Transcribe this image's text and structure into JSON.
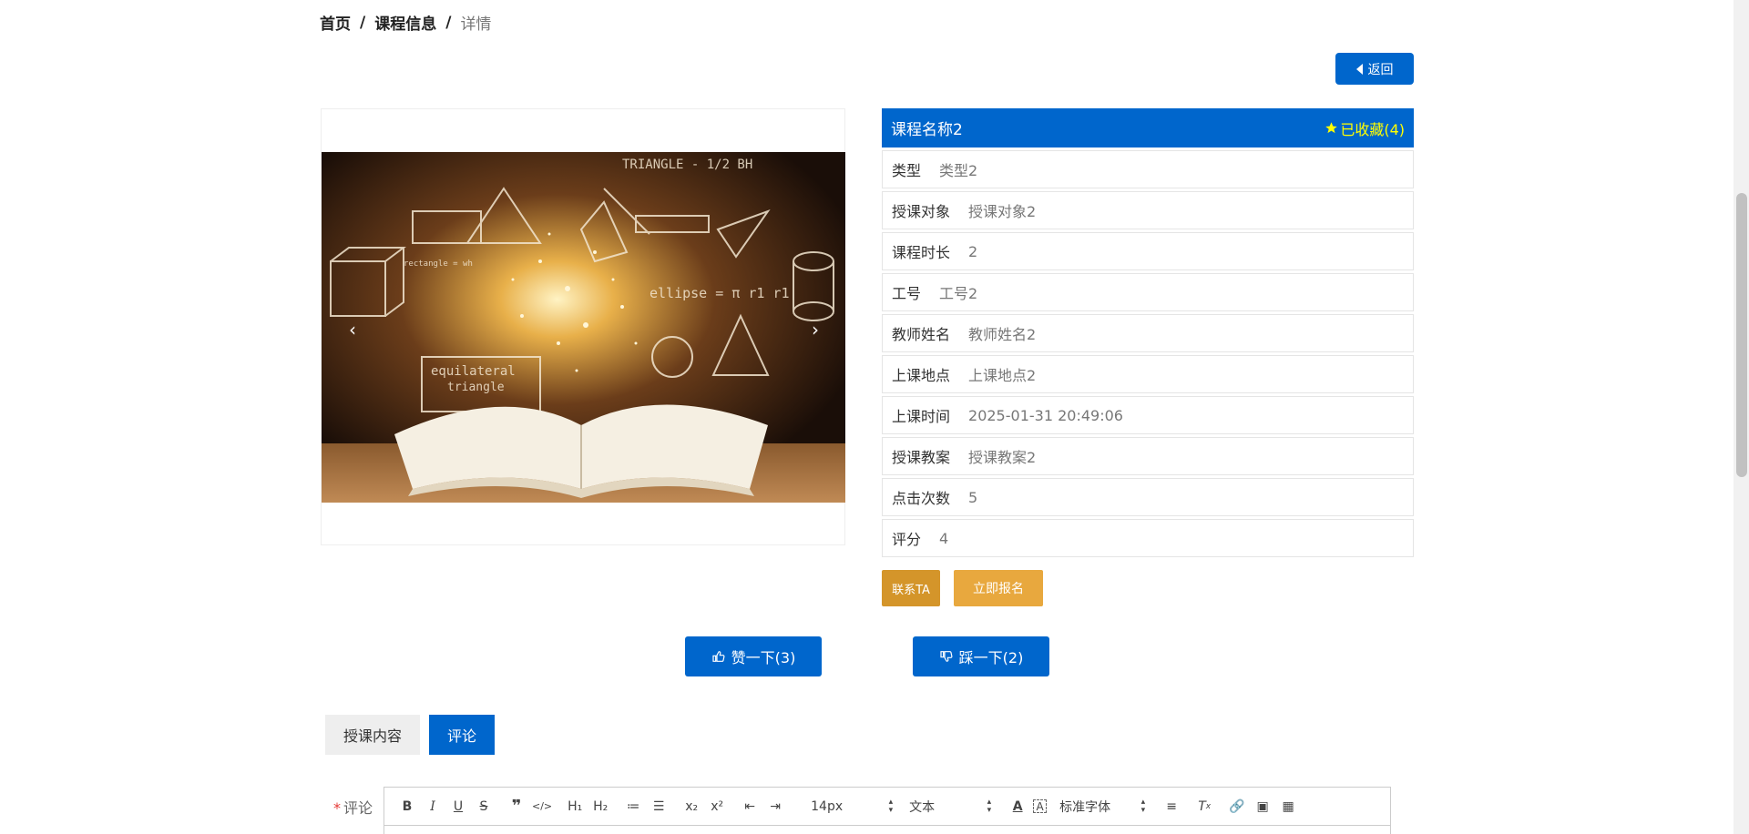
{
  "breadcrumb": {
    "home": "首页",
    "section": "课程信息",
    "current": "详情"
  },
  "back_button": {
    "label": "返回"
  },
  "carousel": {
    "prev": "‹",
    "next": "›"
  },
  "course": {
    "title": "课程名称2",
    "collect_label": "已收藏(4)",
    "fields": [
      {
        "key": "类型",
        "value": "类型2"
      },
      {
        "key": "授课对象",
        "value": "授课对象2"
      },
      {
        "key": "课程时长",
        "value": "2"
      },
      {
        "key": "工号",
        "value": "工号2"
      },
      {
        "key": "教师姓名",
        "value": "教师姓名2"
      },
      {
        "key": "上课地点",
        "value": "上课地点2"
      },
      {
        "key": "上课时间",
        "value": "2025-01-31 20:49:06"
      },
      {
        "key": "授课教案",
        "value": "授课教案2"
      },
      {
        "key": "点击次数",
        "value": "5"
      },
      {
        "key": "评分",
        "value": "4"
      }
    ]
  },
  "actions": {
    "contact": "联系TA",
    "enroll": "立即报名"
  },
  "votes": {
    "like": "赞一下(3)",
    "dislike": "踩一下(2)"
  },
  "tabs": {
    "content": "授课内容",
    "comment": "评论"
  },
  "comment": {
    "required_mark": "*",
    "label": "评论",
    "toolbar": {
      "size": "14px",
      "header": "文本",
      "font": "标准字体"
    }
  },
  "colors": {
    "primary": "#0066cc",
    "collect": "#ffff00",
    "contact": "#d4952a",
    "enroll": "#e8a83e"
  }
}
